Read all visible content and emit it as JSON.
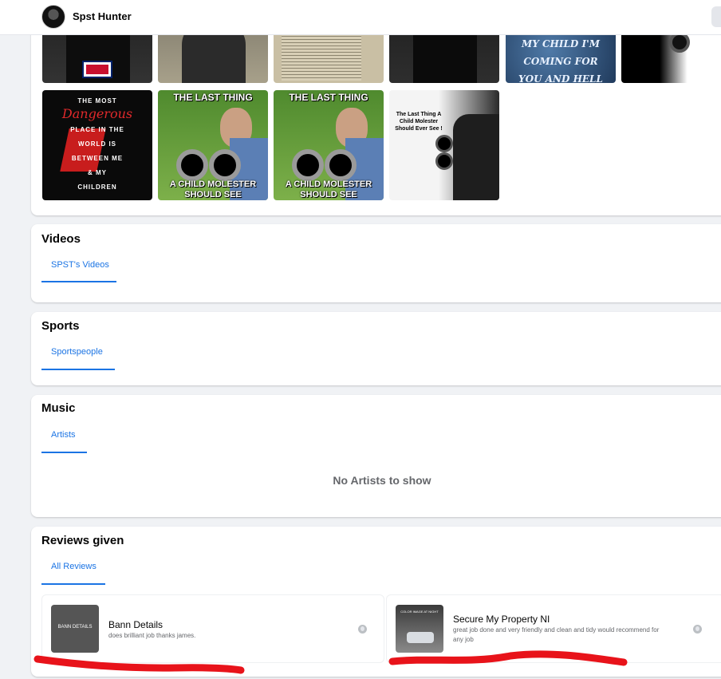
{
  "header": {
    "profile_name": "Spst Hunter"
  },
  "photos": {
    "row1": [
      {
        "icon": "hooded-figure-flag-photo"
      },
      {
        "icon": "man-in-suit-photo"
      },
      {
        "icon": "newspaper-photo"
      },
      {
        "icon": "hooded-figure-photo"
      },
      {
        "text": "MY CHILD I'M COMING FOR YOU AND HELL IS"
      },
      {
        "icon": "gun-barrel-photo"
      }
    ],
    "row2": [
      {
        "lines": [
          "THE MOST",
          "Dangerous",
          "PLACE IN THE",
          "WORLD IS",
          "BETWEEN ME",
          "& MY",
          "CHILDREN"
        ]
      },
      {
        "top": "THE LAST THING",
        "bottom": "A CHILD MOLESTER SHOULD SEE"
      },
      {
        "top": "THE LAST THING",
        "bottom": "A CHILD MOLESTER SHOULD SEE"
      },
      {
        "text": "The Last Thing A Child Molester Should Ever See !"
      }
    ]
  },
  "videos": {
    "title": "Videos",
    "tab": "SPST's Videos"
  },
  "sports": {
    "title": "Sports",
    "tab": "Sportspeople"
  },
  "music": {
    "title": "Music",
    "tab": "Artists",
    "empty": "No Artists to show"
  },
  "reviews": {
    "title": "Reviews given",
    "tab": "All Reviews",
    "items": [
      {
        "thumb_label": "BANN DETAILS",
        "name": "Bann Details",
        "text": "does brilliant job thanks james."
      },
      {
        "thumb_label": "COLOR IMAGE AT NIGHT",
        "name": "Secure My Property NI",
        "text": "great job done and very friendly and clean and tidy would recommend for any job"
      }
    ]
  },
  "colors": {
    "accent": "#1b74e4",
    "scribble": "#e8131a",
    "page_bg": "#f0f2f5"
  }
}
